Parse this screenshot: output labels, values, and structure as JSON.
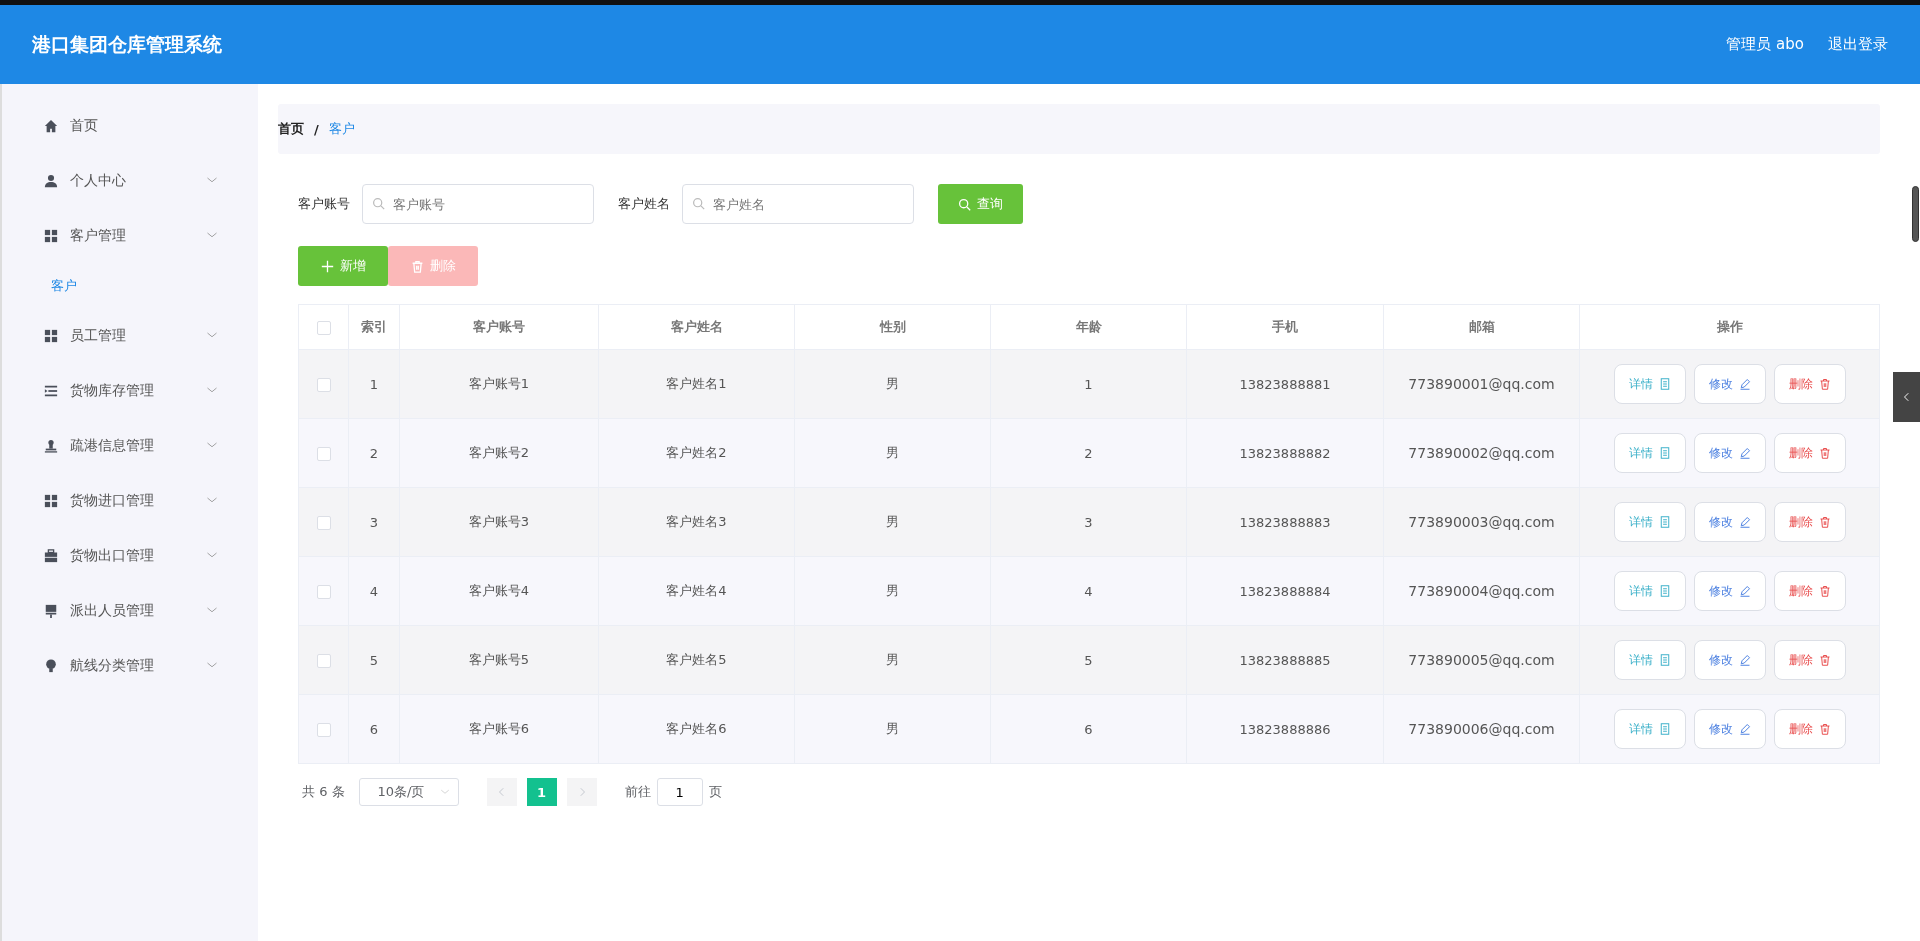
{
  "header": {
    "title": "港口集团仓库管理系统",
    "user": "管理员 abo",
    "logout": "退出登录"
  },
  "sidebar": {
    "items": [
      {
        "label": "首页",
        "kind": "link"
      },
      {
        "label": "个人中心",
        "kind": "submenu"
      },
      {
        "label": "客户管理",
        "kind": "submenu",
        "children": [
          {
            "label": "客户",
            "selected": true
          }
        ]
      },
      {
        "label": "员工管理",
        "kind": "submenu"
      },
      {
        "label": "货物库存管理",
        "kind": "submenu"
      },
      {
        "label": "疏港信息管理",
        "kind": "submenu"
      },
      {
        "label": "货物进口管理",
        "kind": "submenu"
      },
      {
        "label": "货物出口管理",
        "kind": "submenu"
      },
      {
        "label": "派出人员管理",
        "kind": "submenu"
      },
      {
        "label": "航线分类管理",
        "kind": "submenu"
      }
    ]
  },
  "breadcrumb": [
    {
      "label": "首页",
      "selected": false
    },
    {
      "label": "客户",
      "selected": true
    }
  ],
  "breadcrumb_separator": "/",
  "search": {
    "fields": [
      {
        "label": "客户账号",
        "placeholder": "客户账号"
      },
      {
        "label": "客户姓名",
        "placeholder": "客户姓名"
      }
    ],
    "button": "查询"
  },
  "toolbar": [
    {
      "kind": "add",
      "label": "新增",
      "disabled": false
    },
    {
      "kind": "delete",
      "label": "删除",
      "disabled": true
    }
  ],
  "table": {
    "columns": [
      "索引",
      "客户账号",
      "客户姓名",
      "性别",
      "年龄",
      "手机",
      "邮箱",
      "操作"
    ],
    "all_checked": false,
    "rows": [
      {
        "checked": false,
        "cells": [
          "1",
          "客户账号1",
          "客户姓名1",
          "男",
          "1",
          "13823888881",
          "773890001@qq.com"
        ],
        "actions": [
          {
            "kind": "detail",
            "label": "详情"
          },
          {
            "kind": "edit",
            "label": "修改"
          },
          {
            "kind": "delete",
            "label": "删除"
          }
        ]
      },
      {
        "checked": false,
        "cells": [
          "2",
          "客户账号2",
          "客户姓名2",
          "男",
          "2",
          "13823888882",
          "773890002@qq.com"
        ],
        "actions": [
          {
            "kind": "detail",
            "label": "详情"
          },
          {
            "kind": "edit",
            "label": "修改"
          },
          {
            "kind": "delete",
            "label": "删除"
          }
        ]
      },
      {
        "checked": false,
        "cells": [
          "3",
          "客户账号3",
          "客户姓名3",
          "男",
          "3",
          "13823888883",
          "773890003@qq.com"
        ],
        "actions": [
          {
            "kind": "detail",
            "label": "详情"
          },
          {
            "kind": "edit",
            "label": "修改"
          },
          {
            "kind": "delete",
            "label": "删除"
          }
        ]
      },
      {
        "checked": false,
        "cells": [
          "4",
          "客户账号4",
          "客户姓名4",
          "男",
          "4",
          "13823888884",
          "773890004@qq.com"
        ],
        "actions": [
          {
            "kind": "detail",
            "label": "详情"
          },
          {
            "kind": "edit",
            "label": "修改"
          },
          {
            "kind": "delete",
            "label": "删除"
          }
        ]
      },
      {
        "checked": false,
        "cells": [
          "5",
          "客户账号5",
          "客户姓名5",
          "男",
          "5",
          "13823888885",
          "773890005@qq.com"
        ],
        "actions": [
          {
            "kind": "detail",
            "label": "详情"
          },
          {
            "kind": "edit",
            "label": "修改"
          },
          {
            "kind": "delete",
            "label": "删除"
          }
        ]
      },
      {
        "checked": false,
        "cells": [
          "6",
          "客户账号6",
          "客户姓名6",
          "男",
          "6",
          "13823888886",
          "773890006@qq.com"
        ],
        "actions": [
          {
            "kind": "detail",
            "label": "详情"
          },
          {
            "kind": "edit",
            "label": "修改"
          },
          {
            "kind": "delete",
            "label": "删除"
          }
        ]
      }
    ]
  },
  "pagination": {
    "total": "共 6 条",
    "page_size": "10条/页",
    "pages": [
      {
        "label": "1",
        "selected": true
      }
    ],
    "goto_label": "前往",
    "goto_value": "1",
    "page_suffix": "页"
  }
}
